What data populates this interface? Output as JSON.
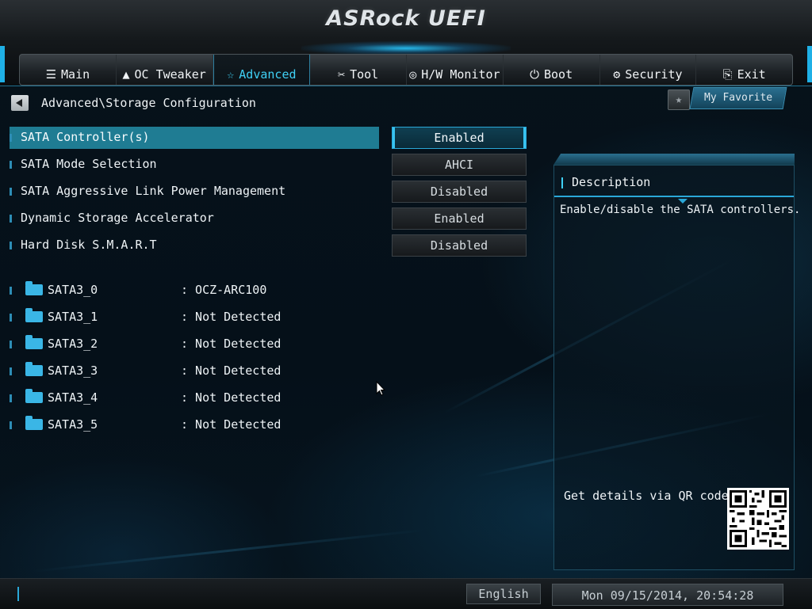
{
  "header": {
    "logo": "ASRock UEFI"
  },
  "tabs": [
    {
      "label": "Main",
      "icon": "menu-list-icon",
      "glyph": "☰"
    },
    {
      "label": "OC Tweaker",
      "icon": "rocket-icon",
      "glyph": "🚀"
    },
    {
      "label": "Advanced",
      "icon": "star-icon",
      "glyph": "☆",
      "active": true
    },
    {
      "label": "Tool",
      "icon": "tools-icon",
      "glyph": "✂"
    },
    {
      "label": "H/W Monitor",
      "icon": "monitor-icon",
      "glyph": "◎"
    },
    {
      "label": "Boot",
      "icon": "power-icon",
      "glyph": "⏻"
    },
    {
      "label": "Security",
      "icon": "shield-icon",
      "glyph": "⚙"
    },
    {
      "label": "Exit",
      "icon": "exit-door-icon",
      "glyph": "⎘"
    }
  ],
  "breadcrumb": "Advanced\\Storage Configuration",
  "favorite": {
    "label": "My Favorite",
    "star": "★"
  },
  "settings": [
    {
      "label": "SATA Controller(s)",
      "value": "Enabled",
      "selected": true
    },
    {
      "label": "SATA Mode Selection",
      "value": "AHCI"
    },
    {
      "label": "SATA Aggressive Link Power Management",
      "value": "Disabled"
    },
    {
      "label": "Dynamic Storage Accelerator",
      "value": "Enabled"
    },
    {
      "label": "Hard Disk S.M.A.R.T",
      "value": "Disabled"
    }
  ],
  "drives": [
    {
      "name": "SATA3_0",
      "value": ": OCZ-ARC100"
    },
    {
      "name": "SATA3_1",
      "value": ": Not Detected"
    },
    {
      "name": "SATA3_2",
      "value": ": Not Detected"
    },
    {
      "name": "SATA3_3",
      "value": ": Not Detected"
    },
    {
      "name": "SATA3_4",
      "value": ": Not Detected"
    },
    {
      "name": "SATA3_5",
      "value": ": Not Detected"
    }
  ],
  "description": {
    "title": "Description",
    "text": "Enable/disable the SATA controllers.",
    "qr_label": "Get details via QR code"
  },
  "status": {
    "language": "English",
    "datetime": "Mon 09/15/2014, 20:54:28"
  },
  "colors": {
    "accent": "#2aa8d8",
    "selected_row": "#1f7c93",
    "active_tab_text": "#3fd0f5"
  }
}
